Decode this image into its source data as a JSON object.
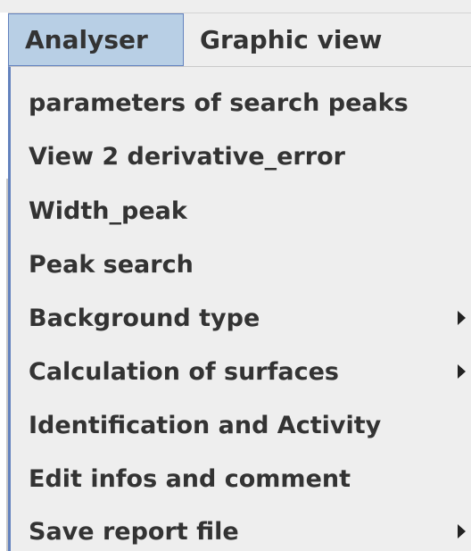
{
  "menubar": {
    "items": [
      {
        "label": "Analyser"
      },
      {
        "label": "Graphic view"
      }
    ]
  },
  "dropdown": {
    "items": [
      {
        "label": "parameters of search peaks",
        "submenu": false
      },
      {
        "label": "View 2 derivative_error",
        "submenu": false
      },
      {
        "label": "Width_peak",
        "submenu": false
      },
      {
        "label": "Peak search",
        "submenu": false
      },
      {
        "label": "Background type",
        "submenu": true
      },
      {
        "label": "Calculation of surfaces",
        "submenu": true
      },
      {
        "label": "Identification and Activity",
        "submenu": false
      },
      {
        "label": "Edit infos and comment",
        "submenu": false
      },
      {
        "label": "Save report file",
        "submenu": true
      }
    ]
  },
  "colors": {
    "menu_background": "#eeeeee",
    "selected_background": "#b8cfe5",
    "selected_border": "#6382be",
    "text": "#333333",
    "arrow": "#222222"
  },
  "icons": {
    "submenu_indicator": "triangle-right-icon"
  }
}
